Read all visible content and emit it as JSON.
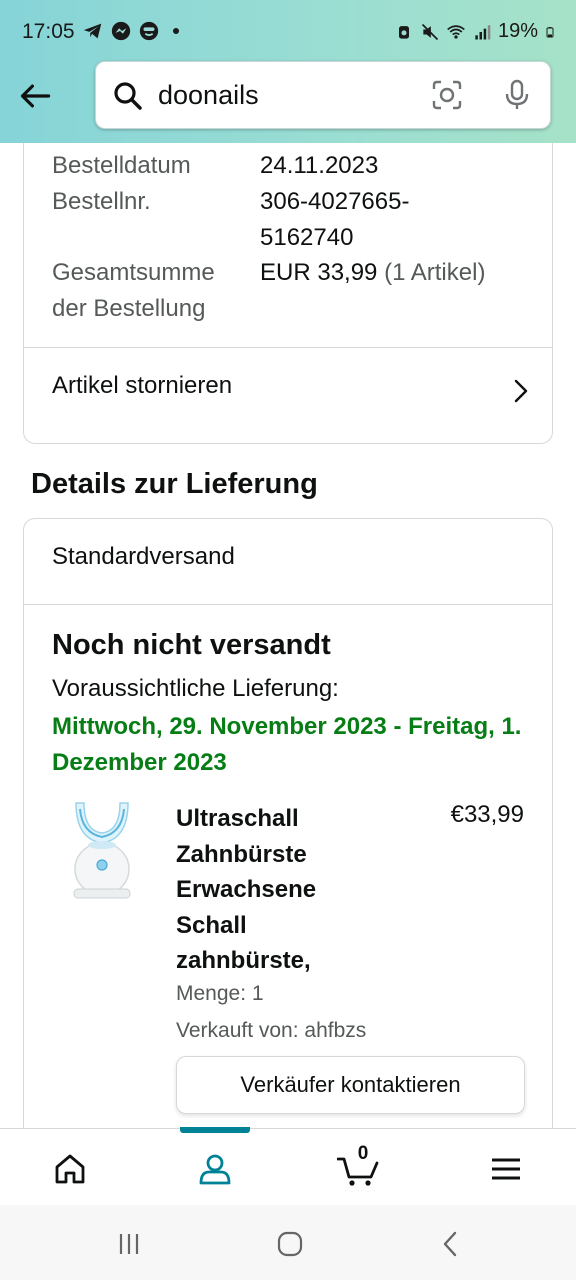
{
  "status_bar": {
    "time": "17:05",
    "battery": "19%",
    "icons": [
      "telegram-icon",
      "messenger-icon",
      "face-icon",
      "dot-icon",
      "alarm-icon",
      "mute-icon",
      "wifi-icon",
      "signal-icon",
      "battery-icon"
    ]
  },
  "header": {
    "search_value": "doonails",
    "icons": [
      "back-arrow-icon",
      "search-icon",
      "camera-icon",
      "mic-icon"
    ]
  },
  "order_info": {
    "rows": [
      {
        "label": "Bestelldatum",
        "value": "24.11.2023"
      },
      {
        "label": "Bestellnr.",
        "value_line1": "306-4027665-",
        "value_line2": "5162740"
      },
      {
        "label_line1": "Gesamtsumme",
        "label_line2": "der Bestellung",
        "value": "EUR 33,99",
        "value_suffix": "(1 Artikel)"
      }
    ],
    "cancel_label": "Artikel stornieren"
  },
  "delivery": {
    "section_title": "Details zur Lieferung",
    "shipping_method": "Standardversand",
    "status": "Noch nicht versandt",
    "expected_label": "Voraussichtliche Lieferung:",
    "expected_date": "Mittwoch, 29. November 2023 - Freitag, 1. Dezember 2023",
    "accent_color": "#067d15"
  },
  "product": {
    "title_lines": [
      "Ultraschall",
      "Zahnbürste",
      "Erwachsene",
      "Schall",
      "zahnbürste,"
    ],
    "price": "€33,99",
    "quantity": "Menge: 1",
    "seller": "Verkauft von: ahfbzs",
    "contact_button": "Verkäufer kontaktieren"
  },
  "bottom_nav": {
    "items": [
      "home-icon",
      "account-icon",
      "cart-icon",
      "menu-icon"
    ],
    "active": "account-icon",
    "cart_count": "0",
    "active_color": "#008296"
  },
  "system_nav": [
    "recent-apps-icon",
    "home-circle-icon",
    "back-icon"
  ]
}
